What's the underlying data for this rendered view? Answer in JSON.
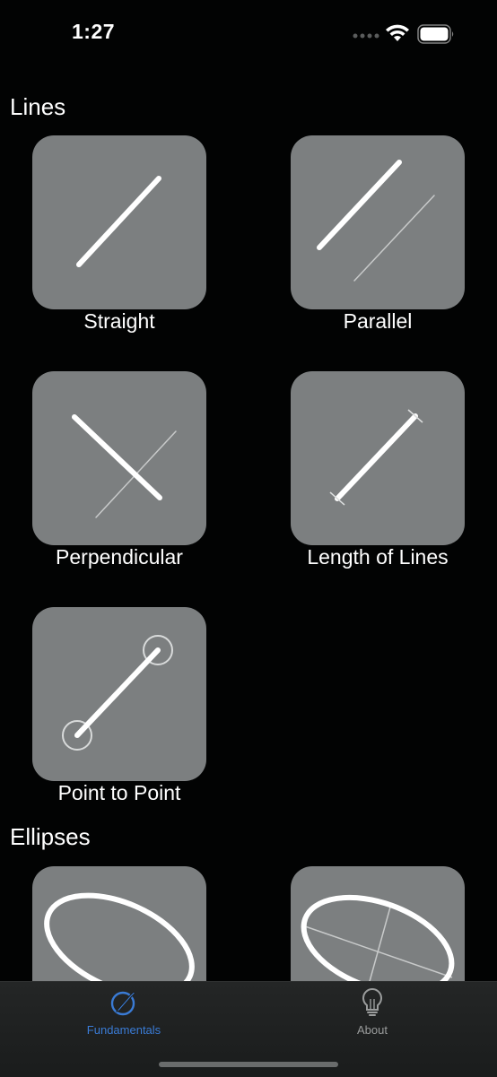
{
  "status_bar": {
    "time": "1:27"
  },
  "sections": {
    "lines": {
      "title": "Lines",
      "items": [
        "Straight",
        "Parallel",
        "Perpendicular",
        "Length of Lines",
        "Point to Point"
      ]
    },
    "ellipses": {
      "title": "Ellipses"
    }
  },
  "tab_bar": {
    "tabs": [
      {
        "label": "Fundamentals",
        "icon": "compass-pen-icon",
        "selected": true
      },
      {
        "label": "About",
        "icon": "lightbulb-icon",
        "selected": false
      }
    ]
  },
  "colors": {
    "background": "#020303",
    "tile": "#7c7f80",
    "accent": "#3a7bd5",
    "tab_inactive": "#9a9c9c"
  }
}
